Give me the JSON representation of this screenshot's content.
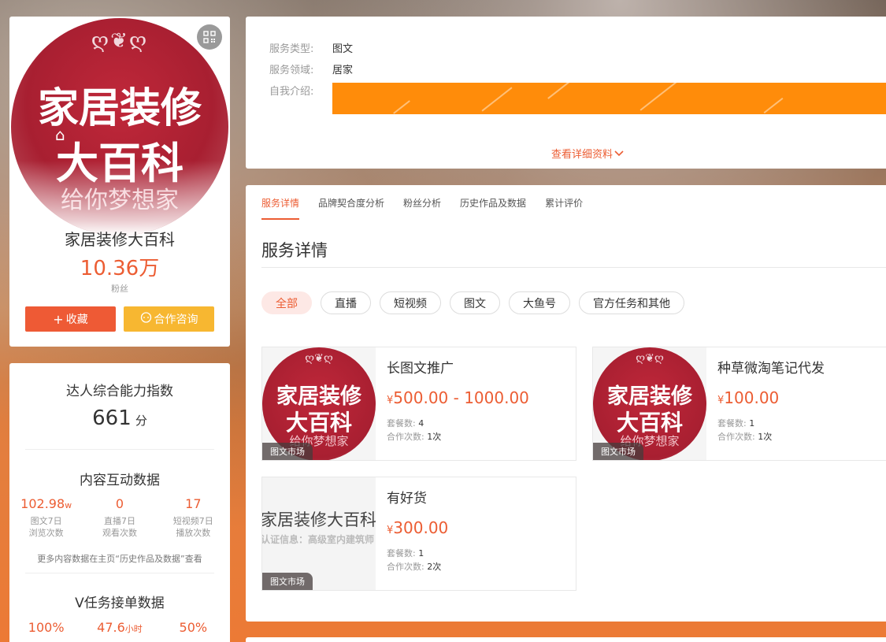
{
  "profile": {
    "logo": {
      "line1": "家居装修",
      "line2": "大百科",
      "line3": "给你梦想家",
      "ornament": "ღ❦ღ"
    },
    "name": "家居装修大百科",
    "fans_count": "10.36万",
    "fans_label": "粉丝",
    "favorite_button": "收藏",
    "consult_button": "合作咨询",
    "favorite_icon": "plus-icon",
    "consult_icon": "chat-icon"
  },
  "stats": {
    "ability_title": "达人综合能力指数",
    "ability_score": "661",
    "ability_unit": "分",
    "interaction_title": "内容互动数据",
    "interaction": [
      {
        "value": "102.98",
        "unit": "w",
        "label_line1": "图文7日",
        "label_line2": "浏览次数"
      },
      {
        "value": "0",
        "unit": "",
        "label_line1": "直播7日",
        "label_line2": "观看次数"
      },
      {
        "value": "17",
        "unit": "",
        "label_line1": "短视频7日",
        "label_line2": "播放次数"
      }
    ],
    "interaction_note": "更多内容数据在主页“历史作品及数据”查看",
    "vtask_title": "V任务接单数据",
    "vtask": [
      {
        "value": "100%",
        "unit": ""
      },
      {
        "value": "47.6",
        "unit": "小时"
      },
      {
        "value": "50%",
        "unit": ""
      }
    ]
  },
  "info": {
    "service_type_label": "服务类型:",
    "service_type_value": "图文",
    "service_domain_label": "服务领域:",
    "service_domain_value": "居家",
    "intro_label": "自我介绍:",
    "more_link": "查看详细资料"
  },
  "detail": {
    "tabs": [
      "服务详情",
      "品牌契合度分析",
      "粉丝分析",
      "历史作品及数据",
      "累计评价"
    ],
    "section_title": "服务详情",
    "filters": [
      "全部",
      "直播",
      "短视频",
      "图文",
      "大鱼号",
      "官方任务和其他"
    ],
    "currency": "¥",
    "qty_label": "套餐数:",
    "count_label": "合作次数:",
    "services": [
      {
        "name": "长图文推广",
        "price": "500.00 - 1000.00",
        "qty": "4",
        "count": "1次",
        "tag": "图文市场"
      },
      {
        "name": "种草微淘笔记代发",
        "price": "100.00",
        "qty": "1",
        "count": "1次",
        "tag": "图文市场"
      },
      {
        "name": "有好货",
        "price": "300.00",
        "qty": "1",
        "count": "2次",
        "tag": "图文市场",
        "image_text1": "家居装修大百科 ",
        "image_text2": "认证信息：高级室内建筑师"
      }
    ]
  },
  "colors": {
    "accent": "#ec5d33",
    "favorite_btn": "#ee5a35",
    "consult_btn": "#f7b731",
    "intro_banner": "#ff8c0a"
  }
}
